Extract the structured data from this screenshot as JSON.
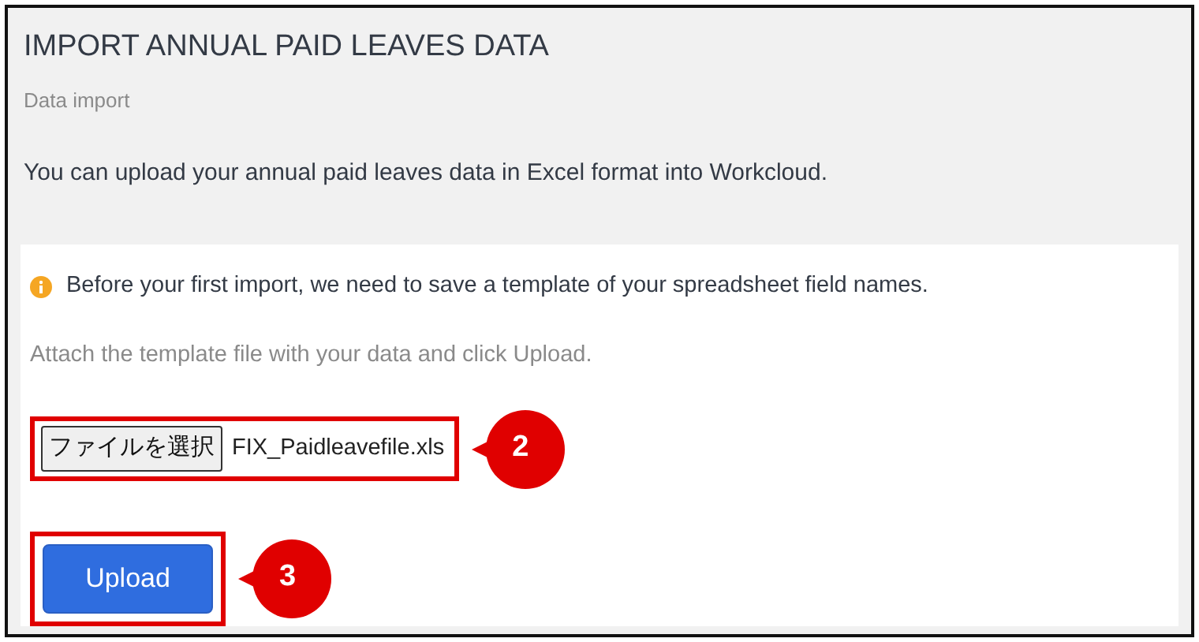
{
  "header": {
    "title": "IMPORT ANNUAL PAID LEAVES DATA",
    "subtitle": "Data import",
    "description": "You can upload your annual paid leaves data in Excel format into Workcloud."
  },
  "notice": {
    "text": "Before your first import, we need to save a template of your spreadsheet field names."
  },
  "instruction": "Attach the template file with your data and click Upload.",
  "file_input": {
    "button_label": "ファイルを選択",
    "file_name": "FIX_Paidleavefile.xls",
    "highlighted": true,
    "callout": "2"
  },
  "upload_button": {
    "label": "Upload",
    "highlighted": true,
    "callout": "3"
  }
}
